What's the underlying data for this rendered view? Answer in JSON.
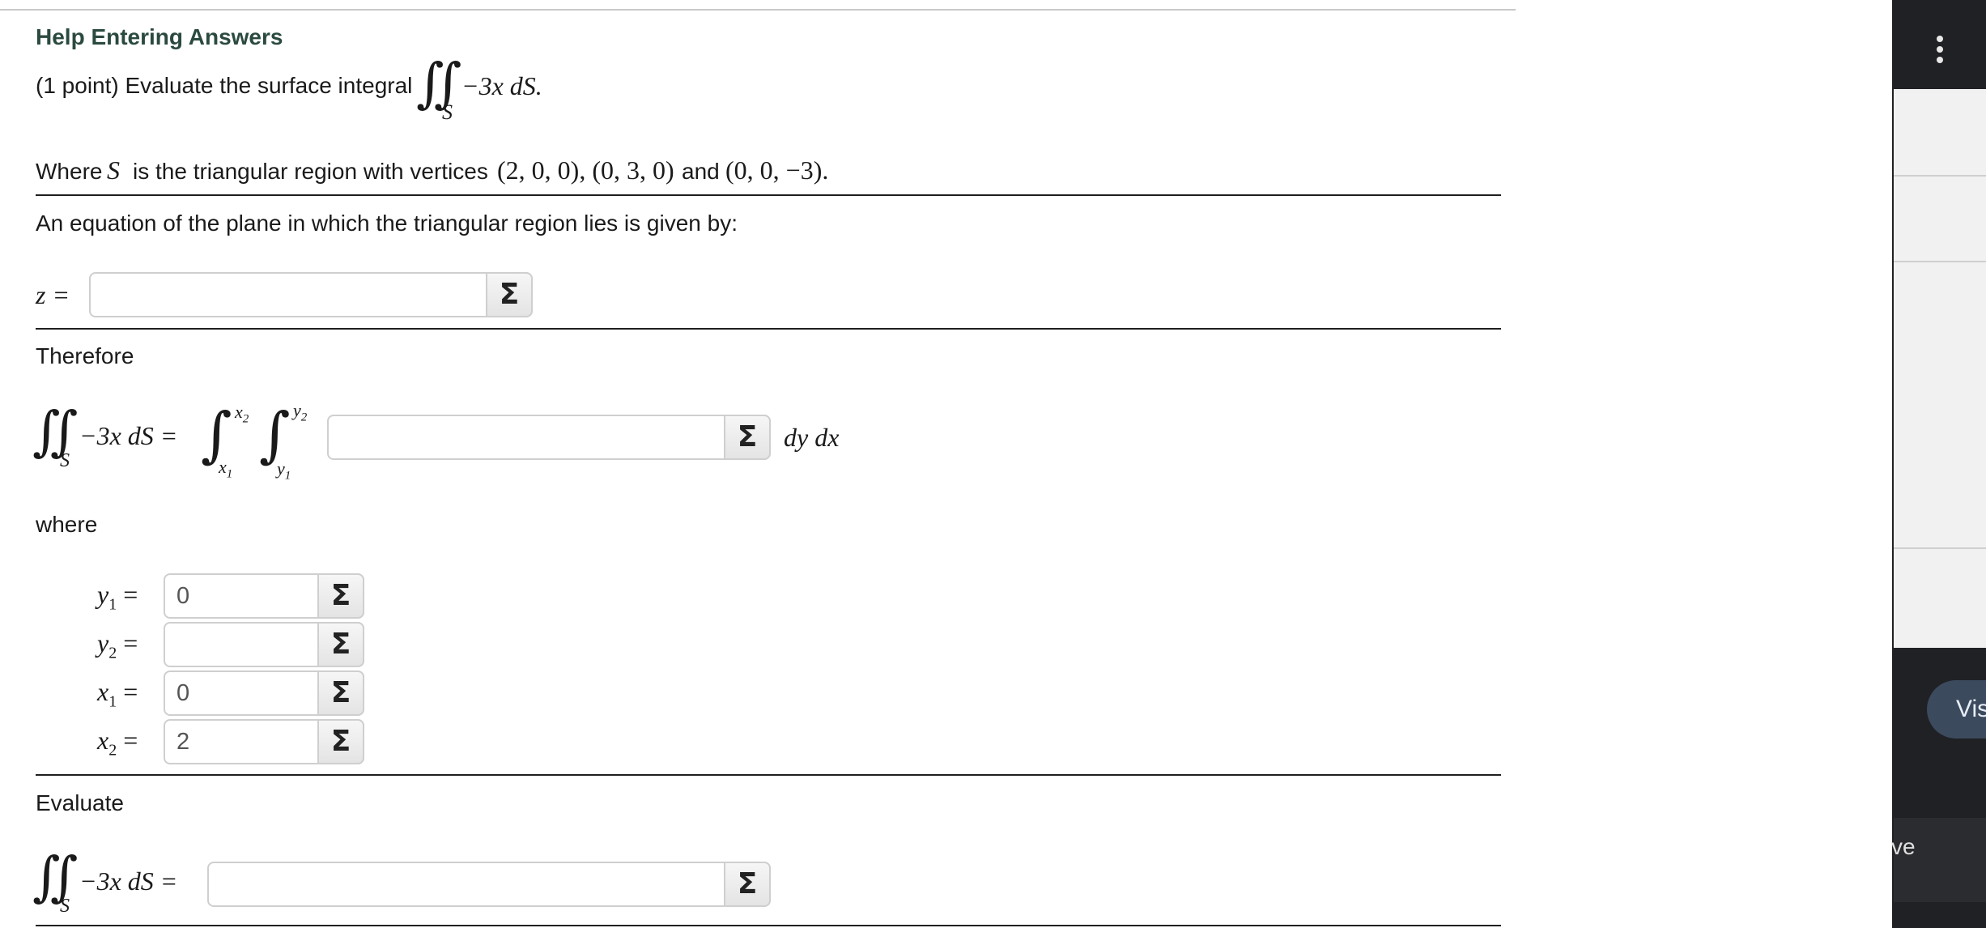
{
  "help_link": "Help Entering Answers",
  "problem": {
    "points_text": "(1 point) Evaluate the surface integral",
    "integrand": "−3x dS.",
    "domain_sub": "S",
    "where_prefix": "Where",
    "where_S": "S",
    "where_text": "is the triangular region with vertices",
    "v1": "(2, 0, 0), (0, 3, 0)",
    "and": "and",
    "v2": "(0, 0, −3)."
  },
  "plane": {
    "prompt": "An equation of the plane in which the triangular region lies is given by:",
    "label": "z =",
    "value": ""
  },
  "therefore": {
    "label": "Therefore",
    "lhs": "−3x dS =",
    "sub_S": "S",
    "outer_upper": "x",
    "outer_upper_sub": "2",
    "outer_lower": "x",
    "outer_lower_sub": "1",
    "inner_upper": "y",
    "inner_upper_sub": "2",
    "inner_lower": "y",
    "inner_lower_sub": "1",
    "integrand_value": "",
    "differentials": "dy dx"
  },
  "where_label": "where",
  "limits": [
    {
      "var": "y",
      "sub": "1",
      "value": "0"
    },
    {
      "var": "y",
      "sub": "2",
      "value": ""
    },
    {
      "var": "x",
      "sub": "1",
      "value": "0"
    },
    {
      "var": "x",
      "sub": "2",
      "value": "2"
    }
  ],
  "evaluate": {
    "label": "Evaluate",
    "lhs": "−3x dS =",
    "sub_S": "S",
    "value": ""
  },
  "sigma_symbol": "Σ",
  "side": {
    "vis_label": "Vis",
    "ve_label": "ve"
  }
}
